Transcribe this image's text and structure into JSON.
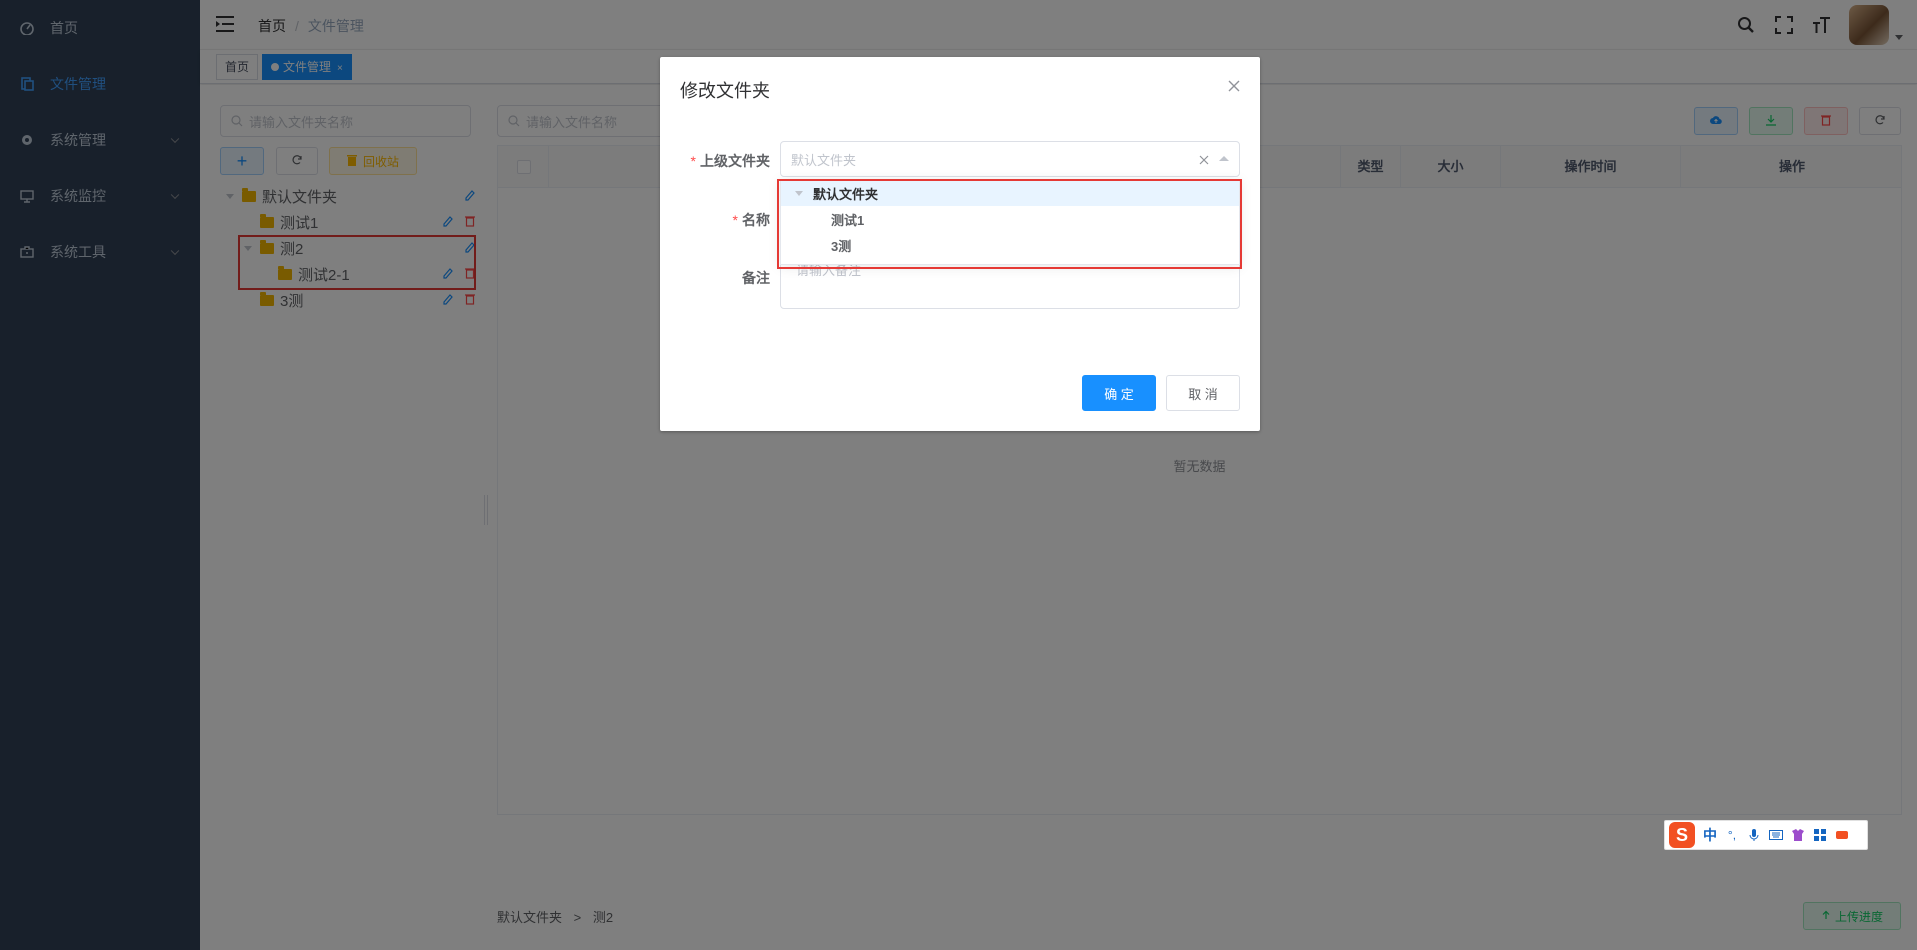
{
  "sidebar": {
    "items": [
      {
        "label": "首页",
        "icon": "dashboard-icon"
      },
      {
        "label": "文件管理",
        "icon": "file-icon",
        "active": true
      },
      {
        "label": "系统管理",
        "icon": "gear-icon"
      },
      {
        "label": "系统监控",
        "icon": "monitor-icon"
      },
      {
        "label": "系统工具",
        "icon": "toolbox-icon"
      }
    ]
  },
  "navbar": {
    "breadcrumb": [
      "首页",
      "文件管理"
    ],
    "separator": "/"
  },
  "tags": [
    {
      "label": "首页"
    },
    {
      "label": "文件管理",
      "close": "×"
    }
  ],
  "left": {
    "folder_search_placeholder": "请输入文件夹名称",
    "add_label": "+",
    "recycle_label": "回收站",
    "tree": [
      {
        "label": "默认文件夹"
      },
      {
        "label": "测试1"
      },
      {
        "label": "测2"
      },
      {
        "label": "测试2-1"
      },
      {
        "label": "3测"
      }
    ]
  },
  "right": {
    "file_search_placeholder": "请输入文件名称",
    "columns": [
      "类型",
      "大小",
      "操作时间",
      "操作"
    ],
    "empty_text": "暂无数据",
    "path": [
      "默认文件夹",
      "测2"
    ],
    "path_sep": ">",
    "upload_progress_label": "上传进度"
  },
  "dialog": {
    "title": "修改文件夹",
    "parent_label": "上级文件夹",
    "parent_placeholder": "默认文件夹",
    "name_label": "名称",
    "remark_label": "备注",
    "remark_placeholder": "请输入备注",
    "required_mark": "*",
    "dropdown": [
      {
        "label": "默认文件夹"
      },
      {
        "label": "测试1"
      },
      {
        "label": "3测"
      }
    ],
    "ok_label": "确 定",
    "cancel_label": "取 消"
  },
  "ime": {
    "logo": "S",
    "mode": "中",
    "punct": "°,"
  },
  "colors": {
    "primary": "#1890ff",
    "sidebar_bg": "#304156",
    "highlight": "#e53935"
  }
}
